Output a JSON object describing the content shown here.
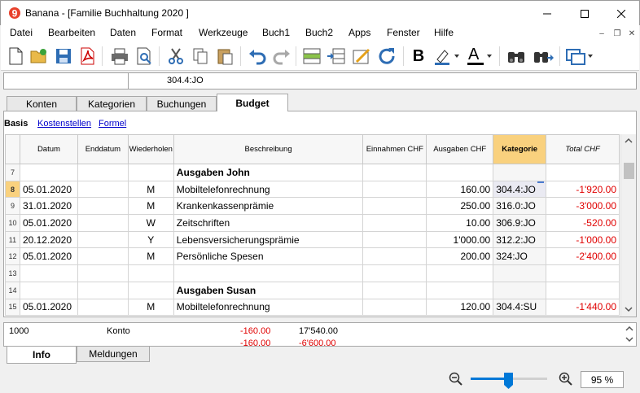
{
  "window": {
    "title": "Banana - [Familie Buchhaltung 2020 ]"
  },
  "menu": [
    "Datei",
    "Bearbeiten",
    "Daten",
    "Format",
    "Werkzeuge",
    "Buch1",
    "Buch2",
    "Apps",
    "Fenster",
    "Hilfe"
  ],
  "toolbar": {
    "icons": [
      "new-icon",
      "open-icon",
      "save-icon",
      "pdf-icon",
      "print-icon",
      "print-preview-icon",
      "cut-icon",
      "copy-icon",
      "paste-icon",
      "undo-icon",
      "redo-icon",
      "insert-row-icon",
      "move-row-icon",
      "edit-icon",
      "refresh-icon",
      "bold-icon",
      "highlight-icon",
      "font-color-icon",
      "binoculars-icon",
      "find-next-icon",
      "window-icon"
    ],
    "bold_label": "B",
    "font_color_label": "A"
  },
  "cellref": {
    "value": "304.4:JO"
  },
  "tabs": [
    "Konten",
    "Kategorien",
    "Buchungen",
    "Budget"
  ],
  "active_tab": "Budget",
  "views": [
    "Basis",
    "Kostenstellen",
    "Formel"
  ],
  "table": {
    "columns": [
      "Datum",
      "Enddatum",
      "Wiederholen",
      "Beschreibung",
      "Einnahmen CHF",
      "Ausgaben CHF",
      "Kategorie",
      "Total CHF"
    ],
    "rows": [
      {
        "n": "7",
        "datum": "",
        "enddatum": "",
        "wiederholen": "",
        "beschreibung": "Ausgaben John",
        "einnahmen": "",
        "ausgaben": "",
        "kategorie": "",
        "total": "",
        "heading": true
      },
      {
        "n": "8",
        "datum": "05.01.2020",
        "enddatum": "",
        "wiederholen": "M",
        "beschreibung": "Mobiltelefonrechnung",
        "einnahmen": "",
        "ausgaben": "160.00",
        "kategorie": "304.4:JO",
        "total": "-1'920.00",
        "current": true
      },
      {
        "n": "9",
        "datum": "31.01.2020",
        "enddatum": "",
        "wiederholen": "M",
        "beschreibung": "Krankenkassenprämie",
        "einnahmen": "",
        "ausgaben": "250.00",
        "kategorie": "316.0:JO",
        "total": "-3'000.00"
      },
      {
        "n": "10",
        "datum": "05.01.2020",
        "enddatum": "",
        "wiederholen": "W",
        "beschreibung": "Zeitschriften",
        "einnahmen": "",
        "ausgaben": "10.00",
        "kategorie": "306.9:JO",
        "total": "-520.00"
      },
      {
        "n": "11",
        "datum": "20.12.2020",
        "enddatum": "",
        "wiederholen": "Y",
        "beschreibung": "Lebensversicherungsprämie",
        "einnahmen": "",
        "ausgaben": "1'000.00",
        "kategorie": "312.2:JO",
        "total": "-1'000.00"
      },
      {
        "n": "12",
        "datum": "05.01.2020",
        "enddatum": "",
        "wiederholen": "M",
        "beschreibung": "Persönliche Spesen",
        "einnahmen": "",
        "ausgaben": "200.00",
        "kategorie": "324:JO",
        "total": "-2'400.00"
      },
      {
        "n": "13",
        "datum": "",
        "enddatum": "",
        "wiederholen": "",
        "beschreibung": "",
        "einnahmen": "",
        "ausgaben": "",
        "kategorie": "",
        "total": ""
      },
      {
        "n": "14",
        "datum": "",
        "enddatum": "",
        "wiederholen": "",
        "beschreibung": "Ausgaben Susan",
        "einnahmen": "",
        "ausgaben": "",
        "kategorie": "",
        "total": "",
        "heading": true
      },
      {
        "n": "15",
        "datum": "05.01.2020",
        "enddatum": "",
        "wiederholen": "M",
        "beschreibung": "Mobiltelefonrechnung",
        "einnahmen": "",
        "ausgaben": "120.00",
        "kategorie": "304.4:SU",
        "total": "-1'440.00"
      }
    ]
  },
  "info": {
    "line1": [
      "1000",
      "Konto",
      "-160.00",
      "17'540.00"
    ],
    "line2": [
      "-160.00",
      "-6'600.00"
    ]
  },
  "bottom_tabs": [
    "Info",
    "Meldungen"
  ],
  "zoom": {
    "label": "95 %",
    "slider_fraction": 0.45
  },
  "colors": {
    "accent": "#0078d7",
    "header_highlight": "#f9d17e",
    "negative": "#e00000",
    "link": "#0000cc"
  }
}
